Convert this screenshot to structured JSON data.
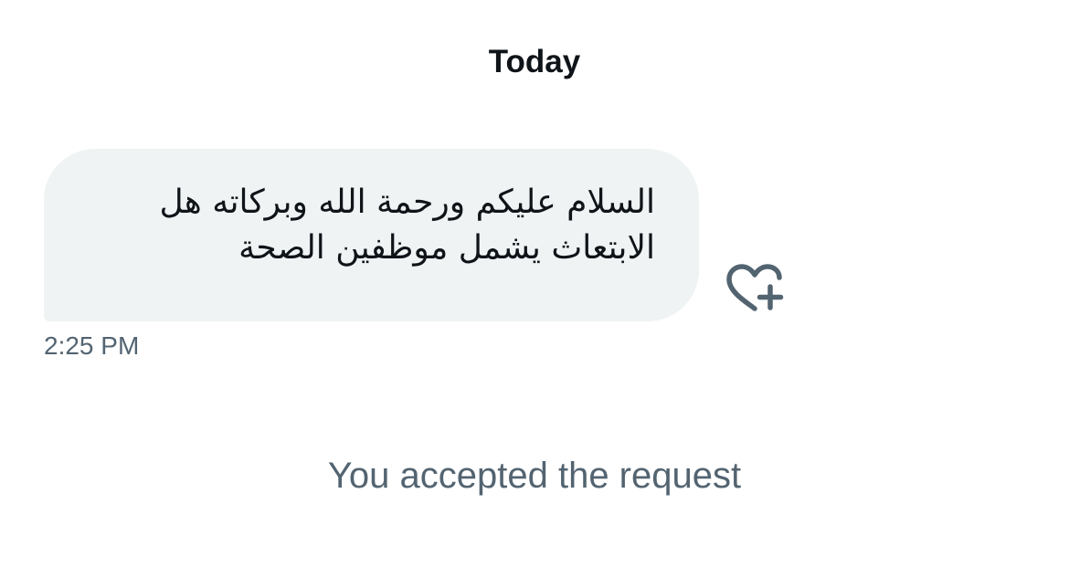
{
  "conversation": {
    "date_header": "Today",
    "message": {
      "line_1": "السلام عليكم ورحمة الله وبركاته هل",
      "line_2": "الابتعاث يشمل موظفين الصحة",
      "timestamp": "2:25 PM",
      "reaction_icon": "heart-plus-icon"
    },
    "system_message": "You accepted the request"
  },
  "colors": {
    "bubble_background": "#eff3f4",
    "primary_text": "#0f1419",
    "secondary_text": "#536471",
    "background": "#ffffff"
  }
}
